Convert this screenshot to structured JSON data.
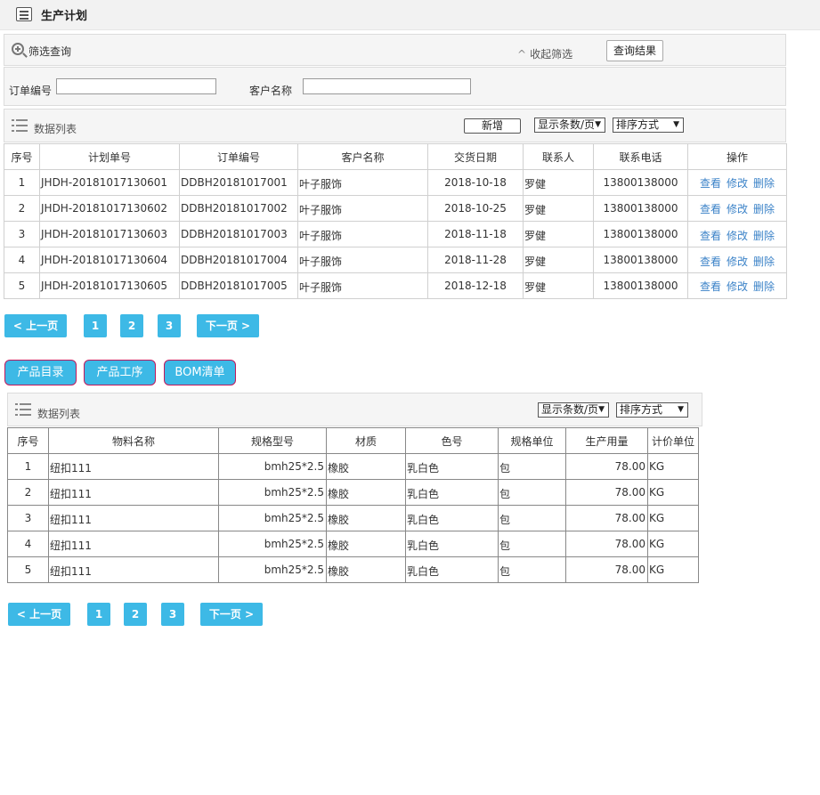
{
  "header": {
    "title": "生产计划"
  },
  "filter": {
    "title": "筛选查询",
    "collapse_label": "收起筛选",
    "query_button": "查询结果",
    "order_no_label": "订单编号",
    "order_no_value": "",
    "customer_label": "客户名称",
    "customer_value": ""
  },
  "list1": {
    "title": "数据列表",
    "add_button": "新增",
    "page_size_select": "显示条数/页",
    "sort_select": "排序方式",
    "columns": [
      "序号",
      "计划单号",
      "订单编号",
      "客户名称",
      "交货日期",
      "联系人",
      "联系电话",
      "操作"
    ],
    "rows": [
      [
        "1",
        "JHDH-20181017130601",
        "DDBH20181017001",
        "叶子服饰",
        "2018-10-18",
        "罗健",
        "13800138000"
      ],
      [
        "2",
        "JHDH-20181017130602",
        "DDBH20181017002",
        "叶子服饰",
        "2018-10-25",
        "罗健",
        "13800138000"
      ],
      [
        "3",
        "JHDH-20181017130603",
        "DDBH20181017003",
        "叶子服饰",
        "2018-11-18",
        "罗健",
        "13800138000"
      ],
      [
        "4",
        "JHDH-20181017130604",
        "DDBH20181017004",
        "叶子服饰",
        "2018-11-28",
        "罗健",
        "13800138000"
      ],
      [
        "5",
        "JHDH-20181017130605",
        "DDBH20181017005",
        "叶子服饰",
        "2018-12-18",
        "罗健",
        "13800138000"
      ]
    ],
    "actions": {
      "view": "查看",
      "edit": "修改",
      "delete": "删除"
    }
  },
  "pager1": {
    "prev": "< 上一页",
    "pages": [
      "1",
      "2",
      "3"
    ],
    "next": "下一页 >"
  },
  "tabs": [
    "产品目录",
    "产品工序",
    "BOM清单"
  ],
  "list2": {
    "title": "数据列表",
    "page_size_select": "显示条数/页",
    "sort_select": "排序方式",
    "columns": [
      "序号",
      "物料名称",
      "规格型号",
      "材质",
      "色号",
      "规格单位",
      "生产用量",
      "计价单位"
    ],
    "rows": [
      [
        "1",
        "纽扣111",
        "bmh25*2.5",
        "橡胶",
        "乳白色",
        "包",
        "78.00",
        "KG"
      ],
      [
        "2",
        "纽扣111",
        "bmh25*2.5",
        "橡胶",
        "乳白色",
        "包",
        "78.00",
        "KG"
      ],
      [
        "3",
        "纽扣111",
        "bmh25*2.5",
        "橡胶",
        "乳白色",
        "包",
        "78.00",
        "KG"
      ],
      [
        "4",
        "纽扣111",
        "bmh25*2.5",
        "橡胶",
        "乳白色",
        "包",
        "78.00",
        "KG"
      ],
      [
        "5",
        "纽扣111",
        "bmh25*2.5",
        "橡胶",
        "乳白色",
        "包",
        "78.00",
        "KG"
      ]
    ]
  },
  "pager2": {
    "prev": "< 上一页",
    "pages": [
      "1",
      "2",
      "3"
    ],
    "next": "下一页 >"
  },
  "colors": {
    "accent": "#3db9e6",
    "link": "#3c83c8",
    "tab_border": "#c2185b"
  },
  "icons": [
    "list-icon",
    "zoom-in-icon",
    "chevron-up-icon",
    "dropdown-arrow-icon"
  ]
}
